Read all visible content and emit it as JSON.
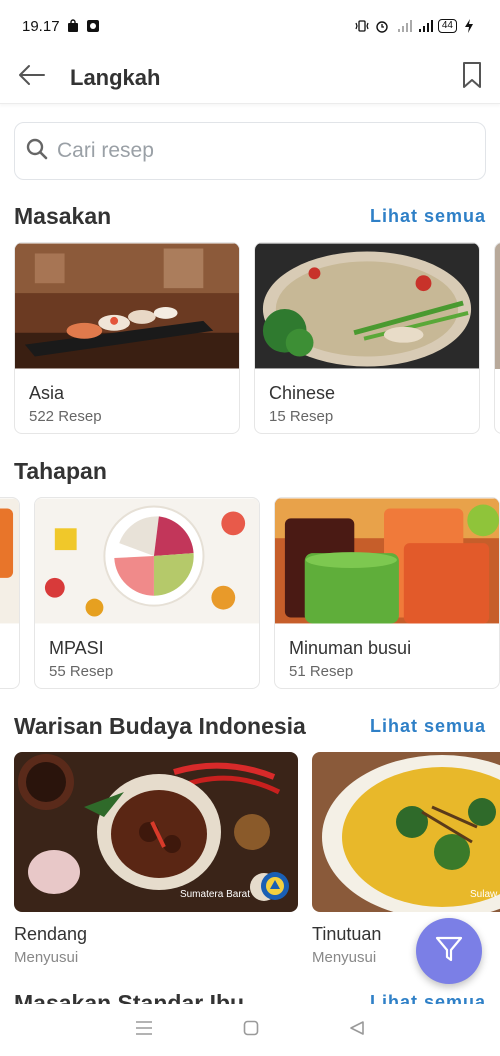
{
  "status_bar": {
    "time": "19.17",
    "battery": "44"
  },
  "app_bar": {
    "title": "Langkah"
  },
  "search": {
    "placeholder": "Cari resep"
  },
  "sections": {
    "masakan": {
      "title": "Masakan",
      "see_all": "Lihat semua",
      "cards": [
        {
          "title": "Asia",
          "subtitle": "522 Resep"
        },
        {
          "title": "Chinese",
          "subtitle": "15 Resep"
        }
      ]
    },
    "tahapan": {
      "title": "Tahapan",
      "cards": [
        {
          "title": "MPASI",
          "subtitle": "55 Resep"
        },
        {
          "title": "Minuman busui",
          "subtitle": "51 Resep"
        }
      ]
    },
    "warisan": {
      "title": "Warisan Budaya Indonesia",
      "see_all": "Lihat semua",
      "cards": [
        {
          "title": "Rendang",
          "subtitle": "Menyusui",
          "region": "Sumatera Barat"
        },
        {
          "title": "Tinutuan",
          "subtitle": "Menyusui",
          "region": "Sulaw"
        }
      ]
    },
    "standar": {
      "title": "Masakan Standar Ibu",
      "see_all": "Lihat semua"
    }
  },
  "colors": {
    "accent": "#2f80c7",
    "fab": "#7b7fe6"
  }
}
